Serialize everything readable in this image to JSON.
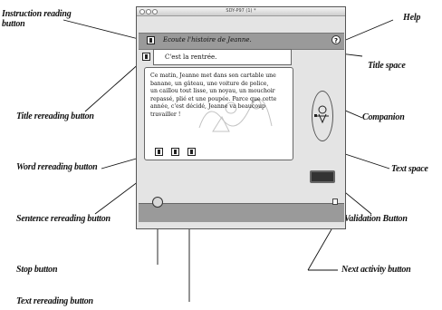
{
  "labels": {
    "instruction_reading_button": "Instruction reading button",
    "help": "Help",
    "title_space": "Title space",
    "title_reading_button": "Title rereading button",
    "companion": "Companion",
    "word_rereading_button": "Word rereading button",
    "text_space": "Text space",
    "sentence_rereading_button": "Sentence rereading button",
    "validation_button": "Validation Button",
    "stop_button": "Stop button",
    "next_activity_button": "Next activity button",
    "text_rereading_button": "Text rereading button"
  },
  "app": {
    "window_title": "SDY-P97 (1) *",
    "instruction": "Ecoute l'histoire de Jeanne.",
    "title": "C'est la rentrée.",
    "story": "Ce matin, Jeanne met dans son cartable une banane, un gâteau, une voiture de police, un caillou tout lisse, un noyau, un mouchoir repassé, plié et une poupée. Parce que cette année, c'est décidé, Jeanne va beaucoup travailler !",
    "help_glyph": "?"
  }
}
